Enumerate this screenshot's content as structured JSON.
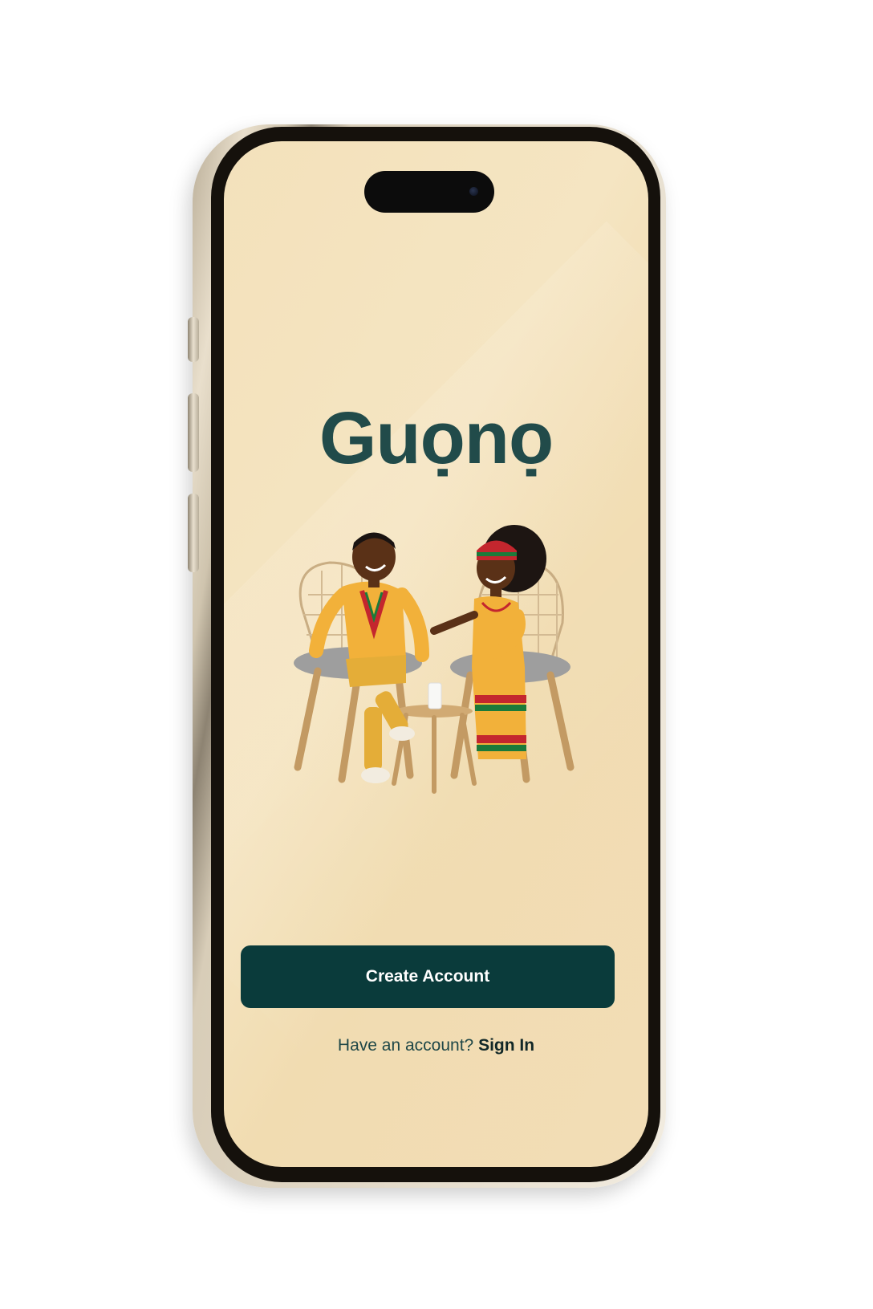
{
  "app": {
    "brand_name": "Guọnọ"
  },
  "welcome": {
    "illustration_icon": "two-people-chatting-illustration",
    "create_account_label": "Create Account",
    "signin_prompt": "Have an account?",
    "signin_link": "Sign In"
  },
  "colors": {
    "screen_background": "#f3e1bb",
    "brand_text": "#214b4a",
    "primary_button": "#0a3b3b",
    "button_text": "#ffffff",
    "frame": "#d8cdb8"
  }
}
